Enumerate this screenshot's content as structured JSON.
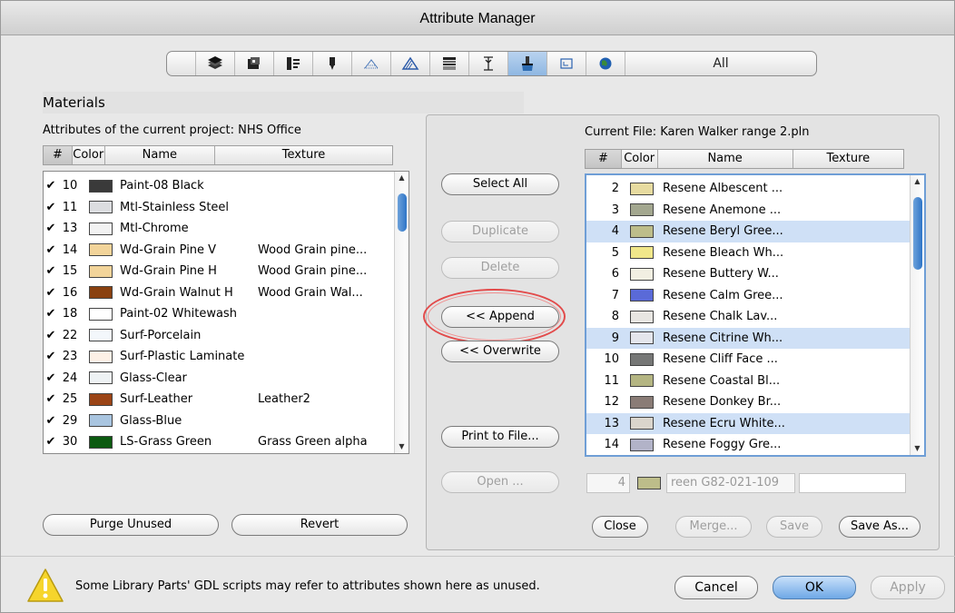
{
  "window": {
    "title": "Attribute Manager"
  },
  "toolbar": {
    "tabs": [
      {
        "icon": "layers-icon"
      },
      {
        "icon": "pens-icon"
      },
      {
        "icon": "line-types-icon"
      },
      {
        "icon": "fill-types-icon"
      },
      {
        "icon": "composites-icon"
      },
      {
        "icon": "profiles-icon"
      },
      {
        "icon": "zones-icon"
      },
      {
        "icon": "building-materials-icon"
      },
      {
        "icon": "materials-icon"
      },
      {
        "icon": "markups-icon"
      },
      {
        "icon": "location-icon"
      }
    ],
    "all_label": "All",
    "selected_tab": "materials-icon"
  },
  "section": {
    "title": "Materials"
  },
  "left": {
    "caption": "Attributes of the current project: NHS Office",
    "headers": {
      "num": "#",
      "color": "Color",
      "name": "Name",
      "texture": "Texture"
    },
    "rows": [
      {
        "check": "✔",
        "num": "10",
        "color": "#3a3a3a",
        "name": "Paint-08 Black",
        "texture": ""
      },
      {
        "check": "✔",
        "num": "11",
        "color": "#dcdde0",
        "name": "Mtl-Stainless Steel",
        "texture": ""
      },
      {
        "check": "✔",
        "num": "13",
        "color": "#f2f2f2",
        "name": "Mtl-Chrome",
        "texture": ""
      },
      {
        "check": "✔",
        "num": "14",
        "color": "#f2d49a",
        "name": "Wd-Grain Pine V",
        "texture": "Wood Grain pine..."
      },
      {
        "check": "✔",
        "num": "15",
        "color": "#f2d49a",
        "name": "Wd-Grain Pine H",
        "texture": "Wood Grain pine..."
      },
      {
        "check": "✔",
        "num": "16",
        "color": "#8a4110",
        "name": "Wd-Grain Walnut H",
        "texture": "Wood Grain Wal..."
      },
      {
        "check": "✔",
        "num": "18",
        "color": "#ffffff",
        "name": "Paint-02 Whitewash",
        "texture": ""
      },
      {
        "check": "✔",
        "num": "22",
        "color": "#f3f7fb",
        "name": "Surf-Porcelain",
        "texture": ""
      },
      {
        "check": "✔",
        "num": "23",
        "color": "#fdf0e6",
        "name": "Surf-Plastic Laminate",
        "texture": ""
      },
      {
        "check": "✔",
        "num": "24",
        "color": "#eef2f4",
        "name": "Glass-Clear",
        "texture": ""
      },
      {
        "check": "✔",
        "num": "25",
        "color": "#9b4416",
        "name": "Surf-Leather",
        "texture": "Leather2"
      },
      {
        "check": "✔",
        "num": "29",
        "color": "#a9c5e0",
        "name": "Glass-Blue",
        "texture": ""
      },
      {
        "check": "✔",
        "num": "30",
        "color": "#0c5a10",
        "name": "LS-Grass Green",
        "texture": "Grass Green alpha"
      }
    ],
    "purge_label": "Purge Unused",
    "revert_label": "Revert"
  },
  "middle": {
    "select_all": "Select All",
    "duplicate": "Duplicate",
    "delete": "Delete",
    "append": "<< Append",
    "overwrite": "<< Overwrite",
    "print": "Print to File...",
    "open": "Open ..."
  },
  "right": {
    "caption": "Current File: Karen Walker range 2.pln",
    "headers": {
      "num": "#",
      "color": "Color",
      "name": "Name",
      "texture": "Texture"
    },
    "rows": [
      {
        "num": "2",
        "color": "#e7dba0",
        "name": "Resene Albescent ...",
        "selected": false
      },
      {
        "num": "3",
        "color": "#a3a78f",
        "name": "Resene Anemone ...",
        "selected": false
      },
      {
        "num": "4",
        "color": "#bdbd8a",
        "name": "Resene Beryl Gree...",
        "selected": true
      },
      {
        "num": "5",
        "color": "#f1e78a",
        "name": "Resene Bleach Wh...",
        "selected": false
      },
      {
        "num": "6",
        "color": "#f2efe2",
        "name": "Resene Buttery W...",
        "selected": false
      },
      {
        "num": "7",
        "color": "#5a6ad8",
        "name": "Resene Calm Gree...",
        "selected": false
      },
      {
        "num": "8",
        "color": "#e8e6e2",
        "name": "Resene Chalk Lav...",
        "selected": false
      },
      {
        "num": "9",
        "color": "#e4e6ec",
        "name": "Resene Citrine Wh...",
        "selected": true
      },
      {
        "num": "10",
        "color": "#767776",
        "name": "Resene Cliff Face ...",
        "selected": false
      },
      {
        "num": "11",
        "color": "#b4b582",
        "name": "Resene Coastal Bl...",
        "selected": false
      },
      {
        "num": "12",
        "color": "#8a7c76",
        "name": "Resene Donkey Br...",
        "selected": false
      },
      {
        "num": "13",
        "color": "#dad5cc",
        "name": "Resene Ecru White...",
        "selected": true
      },
      {
        "num": "14",
        "color": "#b2b3c8",
        "name": "Resene Foggy Gre...",
        "selected": false
      }
    ],
    "detail": {
      "num": "4",
      "color": "#bdbd8a",
      "name": "reen G82-021-109",
      "texture": ""
    },
    "close": "Close",
    "merge": "Merge...",
    "save": "Save",
    "save_as": "Save As..."
  },
  "footer": {
    "warning": "Some Library Parts' GDL scripts may refer to attributes shown here as unused.",
    "cancel": "Cancel",
    "ok": "OK",
    "apply": "Apply"
  }
}
